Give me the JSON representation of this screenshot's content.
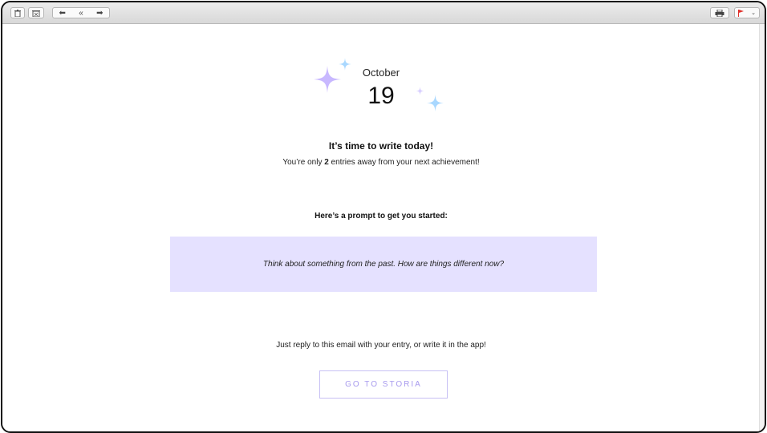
{
  "toolbar": {
    "delete_icon": "trash-icon",
    "junk_icon": "junk-icon",
    "reply_icon": "reply-icon",
    "reply_all_icon": "reply-all-icon",
    "forward_icon": "forward-icon",
    "print_icon": "printer-icon",
    "flag_icon": "flag-icon",
    "flag_color": "#e0312b"
  },
  "email": {
    "month": "October",
    "day": "19",
    "headline": "It’s time to write today!",
    "sub_prefix": "You’re only ",
    "sub_count": "2",
    "sub_suffix": " entries away from your next achievement!",
    "prompt_label": "Here’s a prompt to get you started:",
    "prompt_text": "Think about something from the past. How are things different now?",
    "reply_text": "Just reply to this email with your entry, or write it in the app!",
    "cta_label": "GO TO STORIA",
    "prompt_bg": "#e5e1ff",
    "accent_purple": "#c8b8ff",
    "accent_blue": "#a9d8ff"
  }
}
